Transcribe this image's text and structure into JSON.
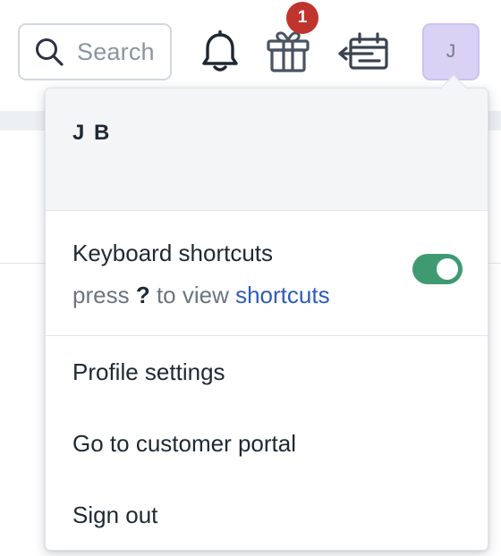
{
  "topbar": {
    "search_placeholder": "Search",
    "notification_badge_count": "1",
    "avatar_initial": "J"
  },
  "menu": {
    "user_name": "J B",
    "shortcuts": {
      "title": "Keyboard shortcuts",
      "hint_prefix": "press",
      "hint_key": "?",
      "hint_middle": "to view",
      "hint_link": "shortcuts",
      "enabled": true
    },
    "items": [
      {
        "label": "Profile settings"
      },
      {
        "label": "Go to customer portal"
      },
      {
        "label": "Sign out"
      }
    ]
  },
  "colors": {
    "badge": "#c0342e",
    "avatar_bg": "#d9d2f4",
    "toggle_on": "#3f9a72",
    "link": "#2f5cb8"
  },
  "icons": [
    "search-icon",
    "bell-icon",
    "gift-icon",
    "calendar-schedule-icon"
  ]
}
